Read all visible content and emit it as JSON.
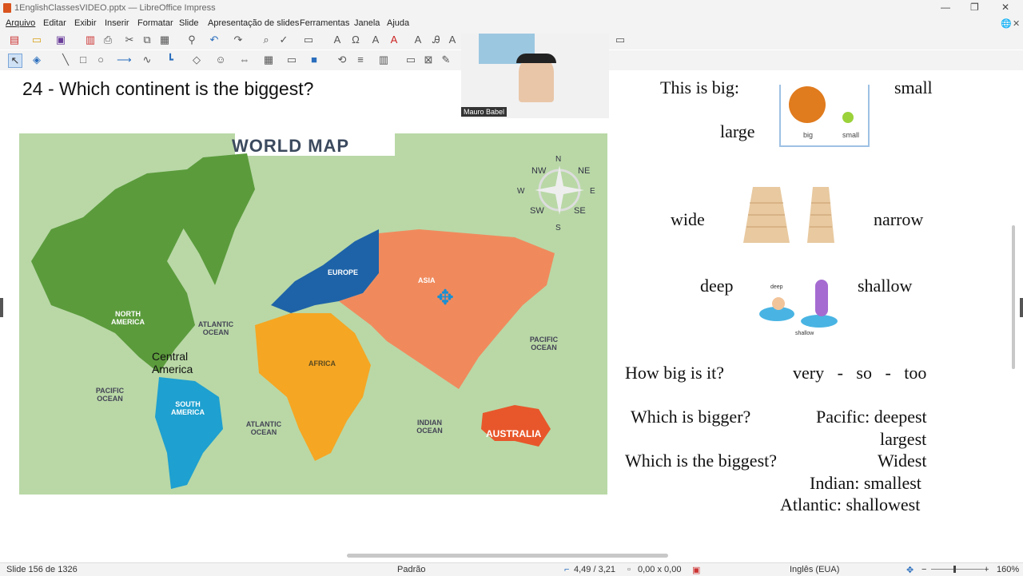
{
  "window": {
    "title": "1EnglishClassesVIDEO.pptx — LibreOffice Impress"
  },
  "menu": [
    "Arquivo",
    "Editar",
    "Exibir",
    "Inserir",
    "Formatar",
    "Slide",
    "Apresentação de slides",
    "Ferramentas",
    "Janela",
    "Ajuda"
  ],
  "slide": {
    "question": "24 -  Which continent is the biggest?",
    "map_title": "WORLD MAP",
    "map_labels": {
      "north_america": "NORTH AMERICA",
      "south_america": "SOUTH AMERICA",
      "europe": "EUROPE",
      "asia": "ASIA",
      "africa": "AFRICA",
      "australia": "AUSTRALIA",
      "atlantic_top": "ATLANTIC OCEAN",
      "atlantic_bottom": "ATLANTIC OCEAN",
      "pacific_left": "PACIFIC OCEAN",
      "pacific_right": "PACIFIC OCEAN",
      "indian": "INDIAN OCEAN",
      "central_america": "Central America",
      "compass_n": "N",
      "compass_s": "S",
      "compass_e": "E",
      "compass_w": "W",
      "compass_nw": "NW",
      "compass_ne": "NE",
      "compass_sw": "SW",
      "compass_se": "SE"
    },
    "vocab": {
      "this_is_big": "This is big:",
      "small": "small",
      "large": "large",
      "img_big": "big",
      "img_small": "small",
      "wide": "wide",
      "narrow": "narrow",
      "deep": "deep",
      "shallow": "shallow",
      "img_deep": "deep",
      "img_shallow": "shallow",
      "how_big": "How big is it?",
      "very_so_too": "very   -   so   -   too",
      "which_bigger": "Which is bigger?",
      "pacific_deepest": "Pacific: deepest",
      "largest": "largest",
      "which_biggest": "Which is the biggest?",
      "widest": "Widest",
      "indian_smallest": "Indian: smallest",
      "atlantic_shallowest": "Atlantic: shallowest"
    },
    "webcam_name": "Mauro Babel"
  },
  "status": {
    "slide": "Slide 156 de 1326",
    "layout": "Padrão",
    "position": "4,49 / 3,21",
    "size": "0,00 x 0,00",
    "language": "Inglês (EUA)",
    "zoom": "160%"
  },
  "colors": {
    "europe": "#1e63a8",
    "asia": "#f08a5d",
    "africa": "#f5a623",
    "n_america": "#5b9b3c",
    "s_america": "#1ea0d0",
    "australia": "#e8572b",
    "ocean": "#b9d8a6"
  }
}
